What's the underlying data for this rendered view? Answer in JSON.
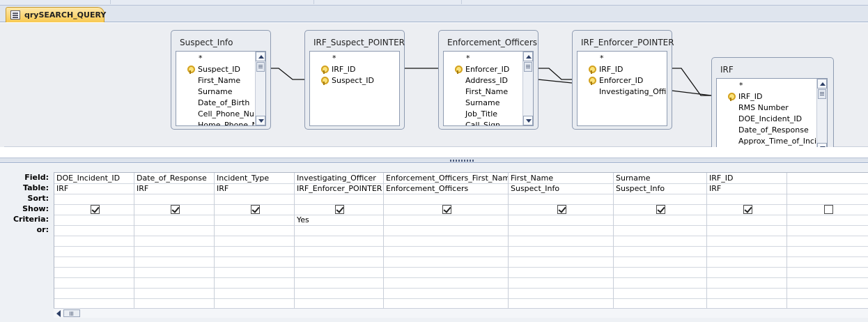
{
  "tab": {
    "label": "qrySEARCH_QUERY",
    "icon": "query-icon"
  },
  "tables": [
    {
      "id": "suspect",
      "title": "Suspect_Info",
      "fields": [
        {
          "name": "*",
          "key": false
        },
        {
          "name": "Suspect_ID",
          "key": true
        },
        {
          "name": "First_Name",
          "key": false
        },
        {
          "name": "Surname",
          "key": false
        },
        {
          "name": "Date_of_Birth",
          "key": false
        },
        {
          "name": "Cell_Phone_Nur",
          "key": false
        },
        {
          "name": "Home_Phone_N",
          "key": false
        }
      ],
      "scrollbar": true
    },
    {
      "id": "irf_suspect",
      "title": "IRF_Suspect_POINTER",
      "fields": [
        {
          "name": "*",
          "key": false
        },
        {
          "name": "IRF_ID",
          "key": true
        },
        {
          "name": "Suspect_ID",
          "key": true
        }
      ],
      "scrollbar": false
    },
    {
      "id": "officers",
      "title": "Enforcement_Officers",
      "fields": [
        {
          "name": "*",
          "key": false
        },
        {
          "name": "Enforcer_ID",
          "key": true
        },
        {
          "name": "Address_ID",
          "key": false
        },
        {
          "name": "First_Name",
          "key": false
        },
        {
          "name": "Surname",
          "key": false
        },
        {
          "name": "Job_Title",
          "key": false
        },
        {
          "name": "Call_Sign",
          "key": false
        }
      ],
      "scrollbar": true
    },
    {
      "id": "irf_enforcer",
      "title": "IRF_Enforcer_POINTER",
      "fields": [
        {
          "name": "*",
          "key": false
        },
        {
          "name": "IRF_ID",
          "key": true
        },
        {
          "name": "Enforcer_ID",
          "key": true
        },
        {
          "name": "Investigating_Offic",
          "key": false
        }
      ],
      "scrollbar": false
    },
    {
      "id": "irf",
      "title": "IRF",
      "fields": [
        {
          "name": "*",
          "key": false
        },
        {
          "name": "IRF_ID",
          "key": true
        },
        {
          "name": "RMS Number",
          "key": false
        },
        {
          "name": "DOE_Incident_ID",
          "key": false
        },
        {
          "name": "Date_of_Response",
          "key": false
        },
        {
          "name": "Approx_Time_of_Incid",
          "key": false
        }
      ],
      "scrollbar": true
    }
  ],
  "row_labels": {
    "field": "Field:",
    "table": "Table:",
    "sort": "Sort:",
    "show": "Show:",
    "criteria": "Criteria:",
    "or": "or:"
  },
  "columns": [
    {
      "field": "DOE_Incident_ID",
      "table": "IRF",
      "sort": "",
      "show": true,
      "criteria": "",
      "or": ""
    },
    {
      "field": "Date_of_Response",
      "table": "IRF",
      "sort": "",
      "show": true,
      "criteria": "",
      "or": ""
    },
    {
      "field": "Incident_Type",
      "table": "IRF",
      "sort": "",
      "show": true,
      "criteria": "",
      "or": ""
    },
    {
      "field": "Investigating_Officer",
      "table": "IRF_Enforcer_POINTER",
      "sort": "",
      "show": true,
      "criteria": "Yes",
      "or": ""
    },
    {
      "field": "Enforcement_Officers_First_Name:",
      "table": "Enforcement_Officers",
      "sort": "",
      "show": true,
      "criteria": "",
      "or": ""
    },
    {
      "field": "First_Name",
      "table": "Suspect_Info",
      "sort": "",
      "show": true,
      "criteria": "",
      "or": ""
    },
    {
      "field": "Surname",
      "table": "Suspect_Info",
      "sort": "",
      "show": true,
      "criteria": "",
      "or": ""
    },
    {
      "field": "IRF_ID",
      "table": "IRF",
      "sort": "",
      "show": true,
      "criteria": "",
      "or": ""
    },
    {
      "field": "",
      "table": "",
      "sort": "",
      "show": false,
      "criteria": "",
      "or": ""
    }
  ],
  "colors": {
    "tab": "#f8c952",
    "pane": "#eceef2",
    "grid_bg": "#eef1f5"
  }
}
